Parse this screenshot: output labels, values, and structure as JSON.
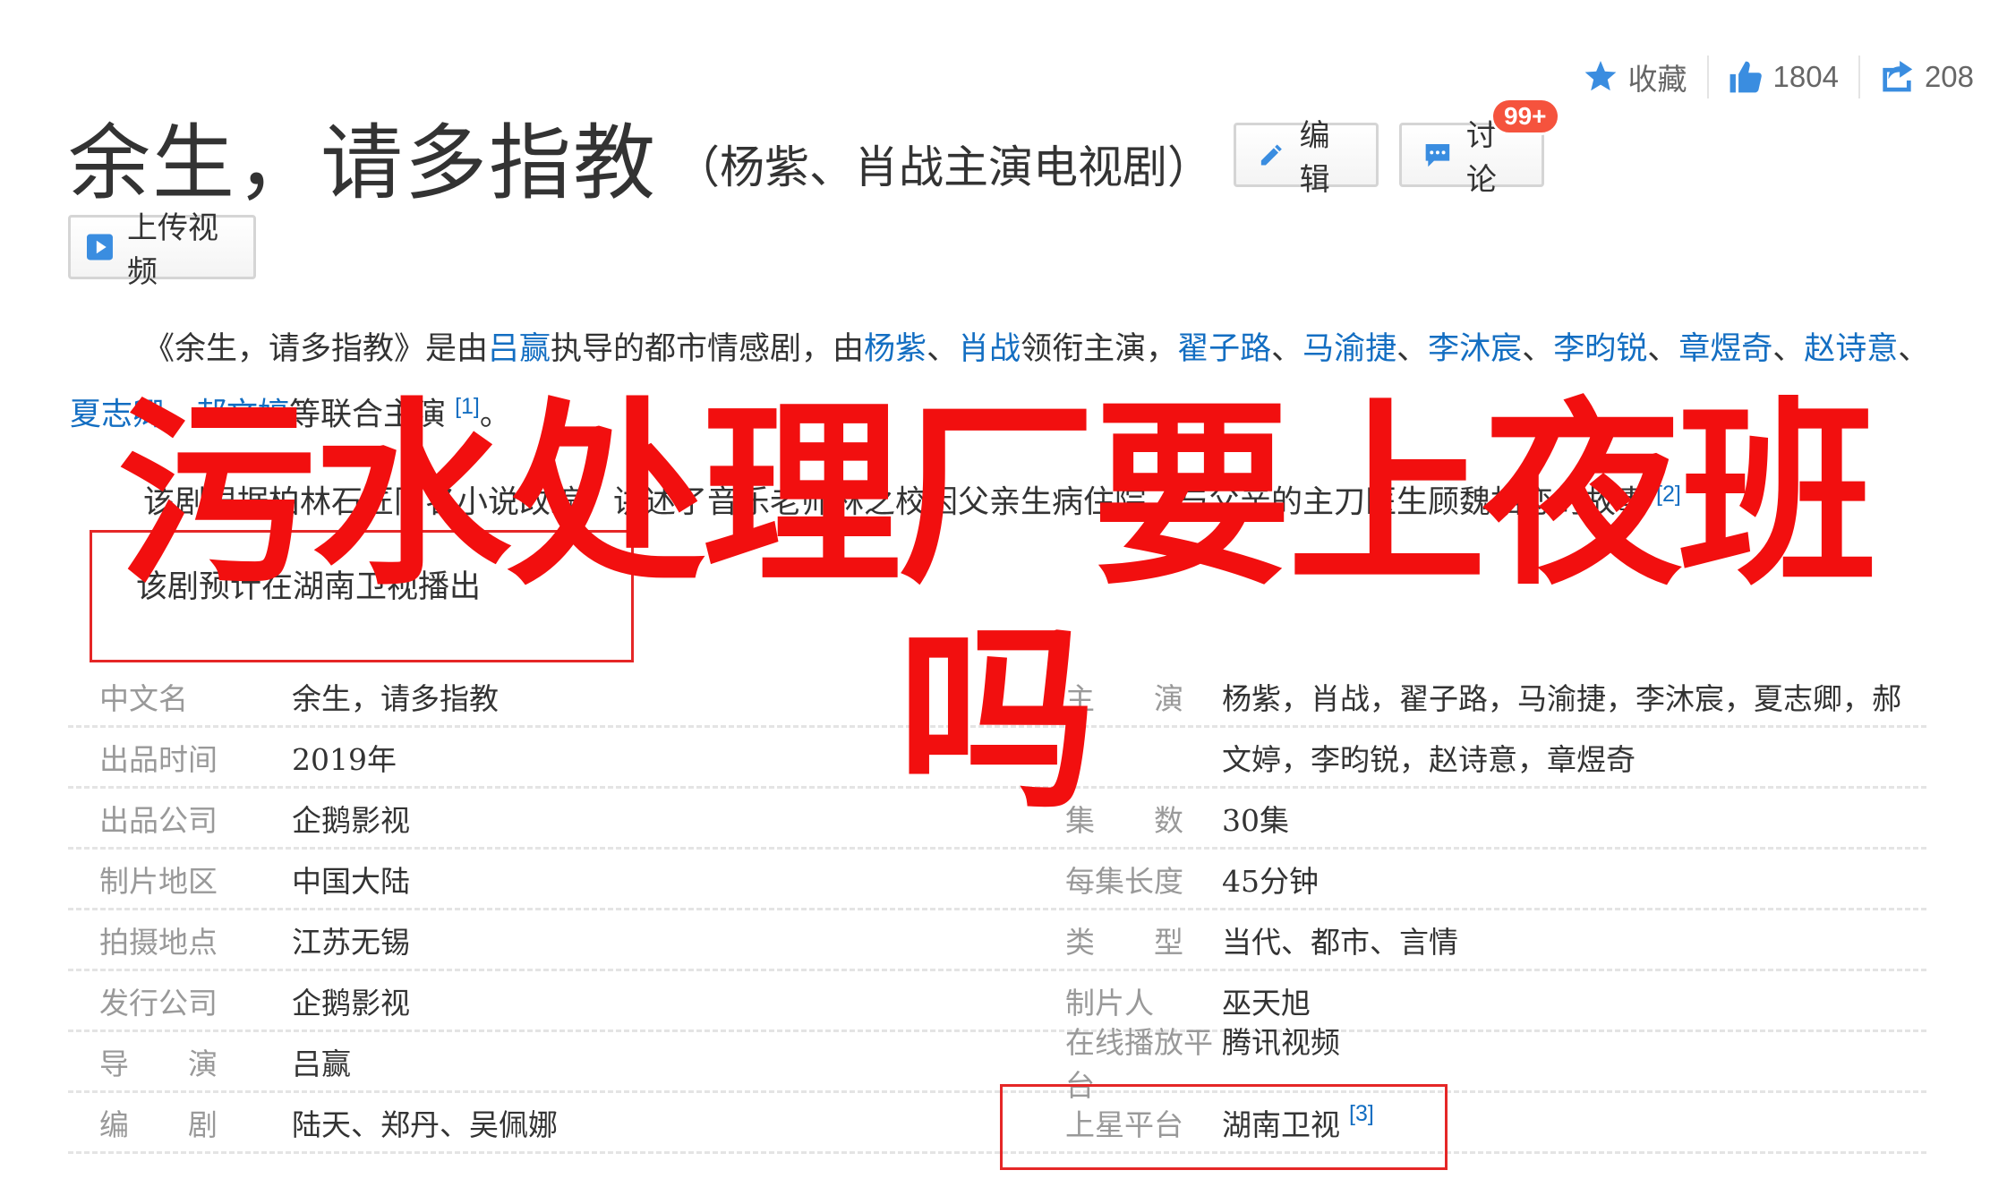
{
  "actions": {
    "favorite_label": "收藏",
    "like_count": "1804",
    "share_count": "208"
  },
  "title": {
    "main": "余生，请多指教",
    "sub": "（杨紫、肖战主演电视剧）"
  },
  "buttons": {
    "edit": "编辑",
    "discuss": "讨论",
    "discuss_badge": "99+",
    "upload": "上传视频"
  },
  "summary": {
    "p1": {
      "s1": "《余生，请多指教》是由",
      "director": "吕赢",
      "s2": "执导的都市情感剧，由",
      "a1": "杨紫",
      "sep1": "、",
      "a2": "肖战",
      "s3": "领衔主演，",
      "a3": "翟子路",
      "sep2": "、",
      "a4": "马渝捷",
      "sep3": "、",
      "a5": "李沐宸",
      "sep4": "、",
      "a6": "李昀锐",
      "sep5": "、",
      "a7": "章煜奇",
      "sep6": "、",
      "a8": "赵诗意",
      "sep7": "、",
      "a9": "夏志卿",
      "sep8": "、",
      "a10": "郝文婷",
      "s4": "等联合主演",
      "ref": "[1]",
      "end": "。"
    },
    "p2": "该剧根据柏林石匠同名小说改编，讲述了音乐老师林之校因父亲生病住院，与父亲的主刀医生顾魏相恋的故事",
    "p2_ref": "[2]",
    "p3": "该剧预计在湖南卫视播出"
  },
  "overlay": {
    "line1": "污水处理厂要上夜班",
    "line2": "吗"
  },
  "info_table": [
    {
      "l_label": "中文名",
      "l_value": "余生，请多指教",
      "r_label": "主　　演",
      "r_value": "杨紫，肖战，翟子路，马渝捷，李沐宸，夏志卿，郝"
    },
    {
      "l_label": "出品时间",
      "l_value": "2019年",
      "r_label": "",
      "r_value": "文婷，李昀锐，赵诗意，章煜奇"
    },
    {
      "l_label": "出品公司",
      "l_value": "企鹅影视",
      "r_label": "集　　数",
      "r_value": "30集"
    },
    {
      "l_label": "制片地区",
      "l_value": "中国大陆",
      "r_label": "每集长度",
      "r_value": "45分钟"
    },
    {
      "l_label": "拍摄地点",
      "l_value": "江苏无锡",
      "r_label": "类　　型",
      "r_value": "当代、都市、言情"
    },
    {
      "l_label": "发行公司",
      "l_value": "企鹅影视",
      "r_label": "制片人",
      "r_value": "巫天旭"
    },
    {
      "l_label": "导　　演",
      "l_value": "吕赢",
      "r_label": "在线播放平台",
      "r_value": "腾讯视频"
    },
    {
      "l_label": "编　　剧",
      "l_value": "陆天、郑丹、吴佩娜",
      "r_label": "上星平台",
      "r_value": "湖南卫视",
      "r_ref": "[3]"
    }
  ],
  "colors": {
    "link": "#136ec2",
    "accent_blue": "#3a8de0",
    "overlay_red": "#f20f0f",
    "badge": "#f5533d"
  }
}
